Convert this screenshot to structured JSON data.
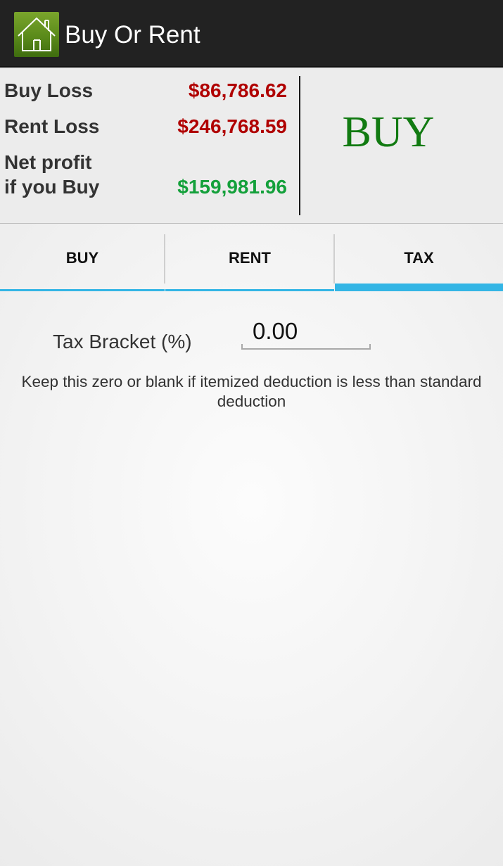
{
  "app": {
    "title": "Buy Or Rent",
    "icon": "house-icon"
  },
  "summary": {
    "rows": [
      {
        "label": "Buy Loss",
        "value": "$86,786.62",
        "color": "#b00000"
      },
      {
        "label": "Rent Loss",
        "value": "$246,768.59",
        "color": "#b00000"
      },
      {
        "label_line1": "Net profit",
        "label_line2": "if you Buy",
        "value": "$159,981.96",
        "color": "#13a03a"
      }
    ],
    "verdict": "BUY",
    "verdict_color": "#117a11"
  },
  "tabs": [
    {
      "label": "BUY",
      "selected": false
    },
    {
      "label": "RENT",
      "selected": false
    },
    {
      "label": "TAX",
      "selected": true
    }
  ],
  "accent_color": "#33b5e5",
  "tax": {
    "field_label": "Tax Bracket (%)",
    "field_value": "0.00",
    "note_line1": "Keep this zero or blank if itemized deduction is less than standard",
    "note_line2": "deduction"
  }
}
